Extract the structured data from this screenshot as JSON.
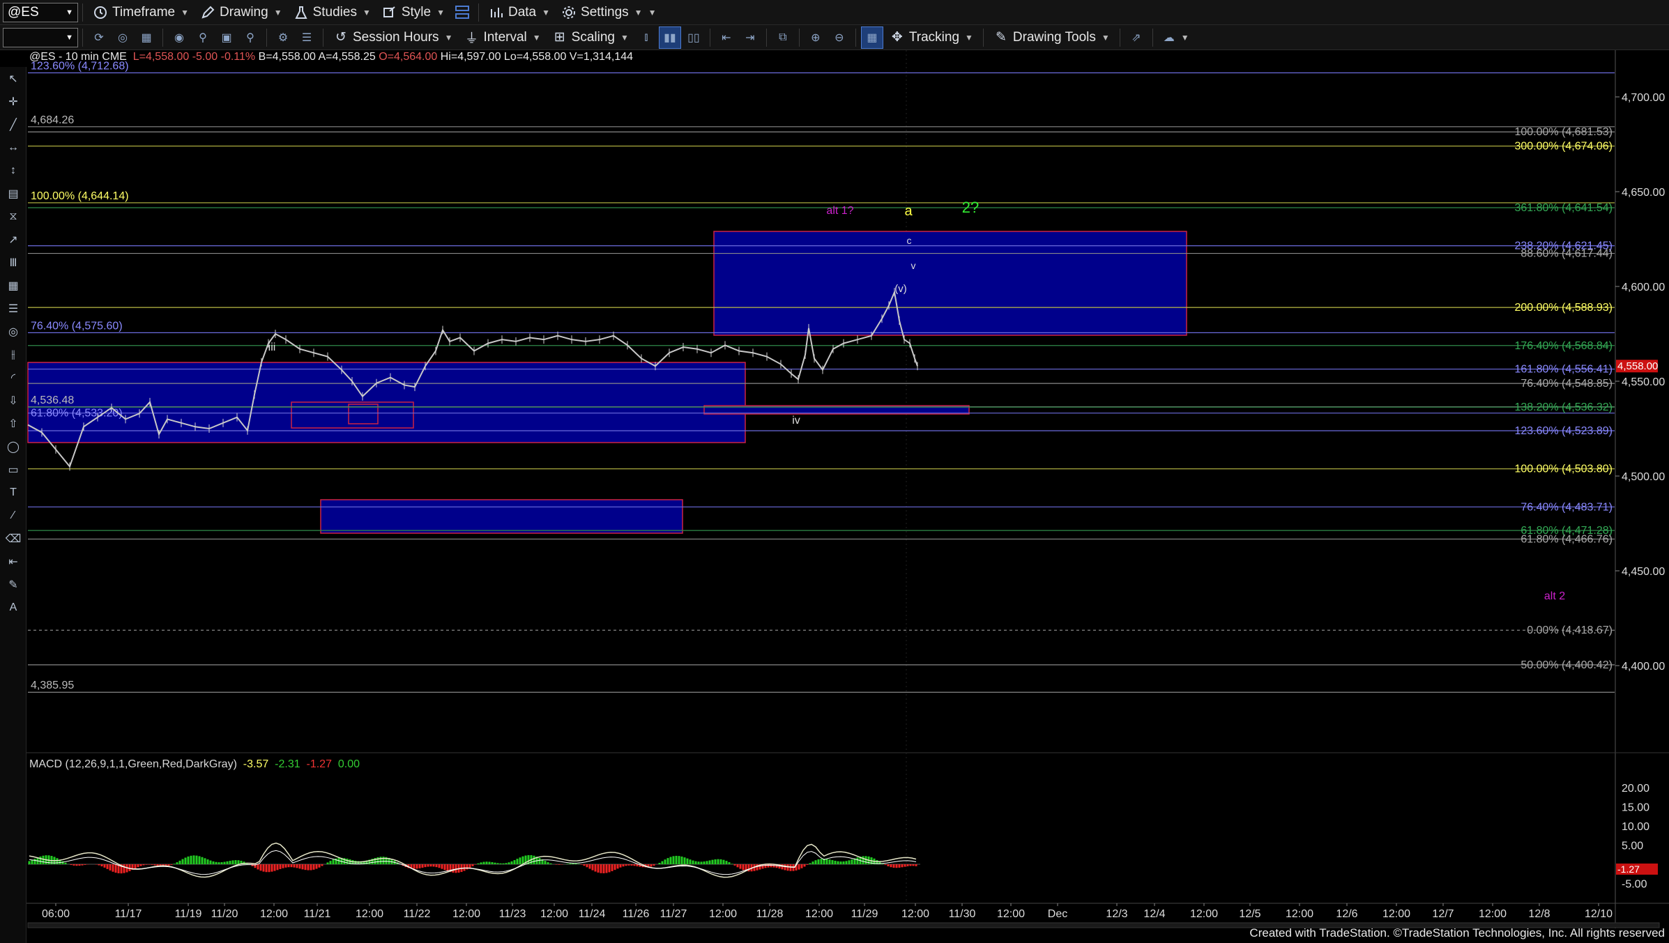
{
  "toolbar": {
    "symbol": "@ES",
    "timeframe": "Timeframe",
    "drawing": "Drawing",
    "studies": "Studies",
    "style": "Style",
    "data": "Data",
    "settings": "Settings",
    "session_hours": "Session Hours",
    "interval": "Interval",
    "scaling": "Scaling",
    "tracking": "Tracking",
    "drawing_tools": "Drawing Tools"
  },
  "symbol_line": {
    "symbol": "@ES - 10 min  CME",
    "last": "L=4,558.00",
    "change": "-5.00",
    "pct": "-0.11%",
    "bid": "B=4,558.00",
    "ask": "A=4,558.25",
    "open": "O=4,564.00",
    "high": "Hi=4,597.00",
    "low": "Lo=4,558.00",
    "volume": "V=1,314,144"
  },
  "macd": {
    "label": "MACD (12,26,9,1,1,Green,Red,DarkGray)",
    "v1": "-3.57",
    "v2": "-2.31",
    "v3": "-1.27",
    "v4": "0.00",
    "axis": [
      "20.00",
      "15.00",
      "10.00",
      "5.00",
      "-5.00"
    ],
    "current": "-1.27"
  },
  "price_axis": [
    "4,700.00",
    "4,650.00",
    "4,600.00",
    "4,550.00",
    "4,500.00",
    "4,450.00",
    "4,400.00"
  ],
  "current_price": "4,558.00",
  "time_axis": [
    "06:00",
    "11/17",
    "11/19",
    "11/20",
    "12:00",
    "11/21",
    "12:00",
    "11/22",
    "12:00",
    "11/23",
    "12:00",
    "11/24",
    "11/26",
    "11/27",
    "12:00",
    "11/28",
    "12:00",
    "11/29",
    "12:00",
    "11/30",
    "12:00",
    "Dec",
    "12/3",
    "12/4",
    "12:00",
    "12/5",
    "12:00",
    "12/6",
    "12:00",
    "12/7",
    "12:00",
    "12/8",
    "12/10"
  ],
  "left_levels": [
    {
      "text": "123.60% (4,712.68)",
      "color": "#8a8aff"
    },
    {
      "text": "4,684.26",
      "color": "#bbbbbb"
    },
    {
      "text": "100.00% (4,644.14)",
      "color": "#ffff66"
    },
    {
      "text": "76.40% (4,575.60)",
      "color": "#8a8aff"
    },
    {
      "text": "4,536.48",
      "color": "#bbbbbb"
    },
    {
      "text": "61.80% (4,533.20)",
      "color": "#8a8aff"
    },
    {
      "text": "4,385.95",
      "color": "#bbbbbb"
    }
  ],
  "right_levels": [
    {
      "text": "100.00% (4,681.53)",
      "color": "#aaaaaa"
    },
    {
      "text": "300.00% (4,674.06)",
      "color": "#ffff66"
    },
    {
      "text": "361.80% (4,641.54)",
      "color": "#33aa55"
    },
    {
      "text": "238.20% (4,621.45)",
      "color": "#8a8aff"
    },
    {
      "text": "88.60% (4,617.44)",
      "color": "#aaaaaa"
    },
    {
      "text": "200.00% (4,588.93)",
      "color": "#ffff66"
    },
    {
      "text": "176.40% (4,568.84)",
      "color": "#33aa55"
    },
    {
      "text": "161.80% (4,556.41)",
      "color": "#8a8aff"
    },
    {
      "text": "76.40% (4,548.85)",
      "color": "#aaaaaa"
    },
    {
      "text": "138.20% (4,536.32)",
      "color": "#33aa55"
    },
    {
      "text": "123.60% (4,523.89)",
      "color": "#8a8aff"
    },
    {
      "text": "100.00% (4,503.80)",
      "color": "#ffff66"
    },
    {
      "text": "76.40% (4,483.71)",
      "color": "#8a8aff"
    },
    {
      "text": "61.80% (4,471.28)",
      "color": "#33aa55"
    },
    {
      "text": "61.80% (4,466.76)",
      "color": "#aaaaaa"
    },
    {
      "text": "0.00% (4,418.67)",
      "color": "#aaaaaa"
    },
    {
      "text": "50.00% (4,400.42)",
      "color": "#aaaaaa"
    }
  ],
  "wave_labels": [
    {
      "text": "iii",
      "color": "#dddddd"
    },
    {
      "text": "alt 1?",
      "color": "#cc22cc"
    },
    {
      "text": "a",
      "color": "#ffff44"
    },
    {
      "text": "2?",
      "color": "#33ee33"
    },
    {
      "text": "c",
      "color": "#dddddd"
    },
    {
      "text": "v",
      "color": "#dddddd"
    },
    {
      "text": "(v)",
      "color": "#dddddd"
    },
    {
      "text": "iv",
      "color": "#dddddd"
    },
    {
      "text": "alt 2",
      "color": "#cc22cc"
    }
  ],
  "colors": {
    "box_fill": "#00008b",
    "box_border": "#cc2244",
    "up": "#22cc22",
    "down": "#ee2222",
    "macd_line": "#e6e6c8"
  },
  "footer": "Created with TradeStation. ©TradeStation Technologies, Inc. All rights reserved"
}
